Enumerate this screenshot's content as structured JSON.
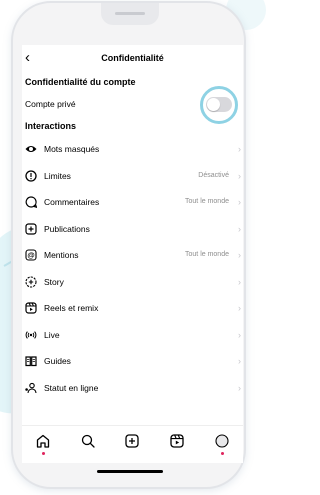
{
  "header": {
    "title": "Confidentialité",
    "back_icon": "chevron-left-icon"
  },
  "account_section": {
    "title": "Confidentialité du compte",
    "private_account": {
      "label": "Compte privé",
      "enabled": false
    }
  },
  "interactions": {
    "title": "Interactions",
    "items": [
      {
        "label": "Mots masqués",
        "value": "",
        "icon": "eye-icon"
      },
      {
        "label": "Limites",
        "value": "Désactivé",
        "icon": "alert-circle-icon"
      },
      {
        "label": "Commentaires",
        "value": "Tout le monde",
        "icon": "comment-icon"
      },
      {
        "label": "Publications",
        "value": "",
        "icon": "plus-square-icon"
      },
      {
        "label": "Mentions",
        "value": "Tout le monde",
        "icon": "at-icon"
      },
      {
        "label": "Story",
        "value": "",
        "icon": "story-add-icon"
      },
      {
        "label": "Reels et remix",
        "value": "",
        "icon": "reels-icon"
      },
      {
        "label": "Live",
        "value": "",
        "icon": "live-icon"
      },
      {
        "label": "Guides",
        "value": "",
        "icon": "guides-icon"
      },
      {
        "label": "Statut en ligne",
        "value": "",
        "icon": "online-status-icon"
      }
    ]
  },
  "bottom_nav": [
    "home-icon",
    "search-icon",
    "create-icon",
    "reels-icon",
    "profile-icon"
  ],
  "colors": {
    "highlight_ring": "#8ed2e4",
    "notification_dot": "#e0245e"
  }
}
